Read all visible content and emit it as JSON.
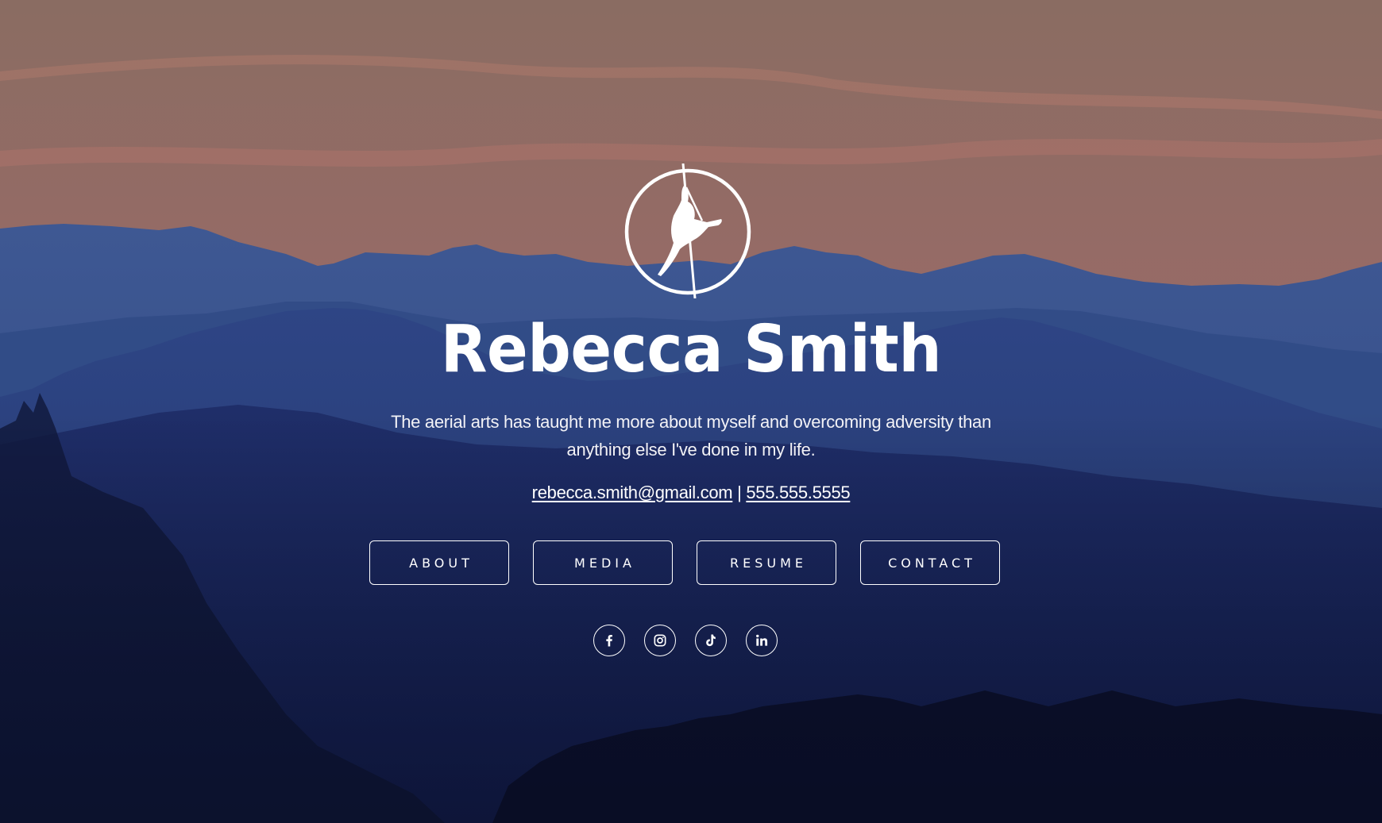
{
  "profile": {
    "name": "Rebecca Smith",
    "tagline": "The aerial arts has taught me more about myself and overcoming adversity than anything else I've done in my life.",
    "email": "rebecca.smith@gmail.com",
    "separator": "|",
    "phone": "555.555.5555"
  },
  "logo": {
    "icon": "aerialist-hoop-icon"
  },
  "nav": {
    "items": [
      {
        "label": "ABOUT"
      },
      {
        "label": "MEDIA"
      },
      {
        "label": "RESUME"
      },
      {
        "label": "CONTACT"
      }
    ]
  },
  "social": {
    "items": [
      {
        "icon": "facebook-icon",
        "label": "Facebook"
      },
      {
        "icon": "instagram-icon",
        "label": "Instagram"
      },
      {
        "icon": "tiktok-icon",
        "label": "TikTok"
      },
      {
        "icon": "linkedin-icon",
        "label": "LinkedIn"
      }
    ]
  },
  "colors": {
    "sky_top": "#8a6a66",
    "sky_glow": "#b06f6c",
    "far_ridge": "#3c5691",
    "mid_ridge": "#2a3f7a",
    "near_ridge": "#1e2a66",
    "foreground": "#0f1430",
    "text": "#ffffff"
  }
}
